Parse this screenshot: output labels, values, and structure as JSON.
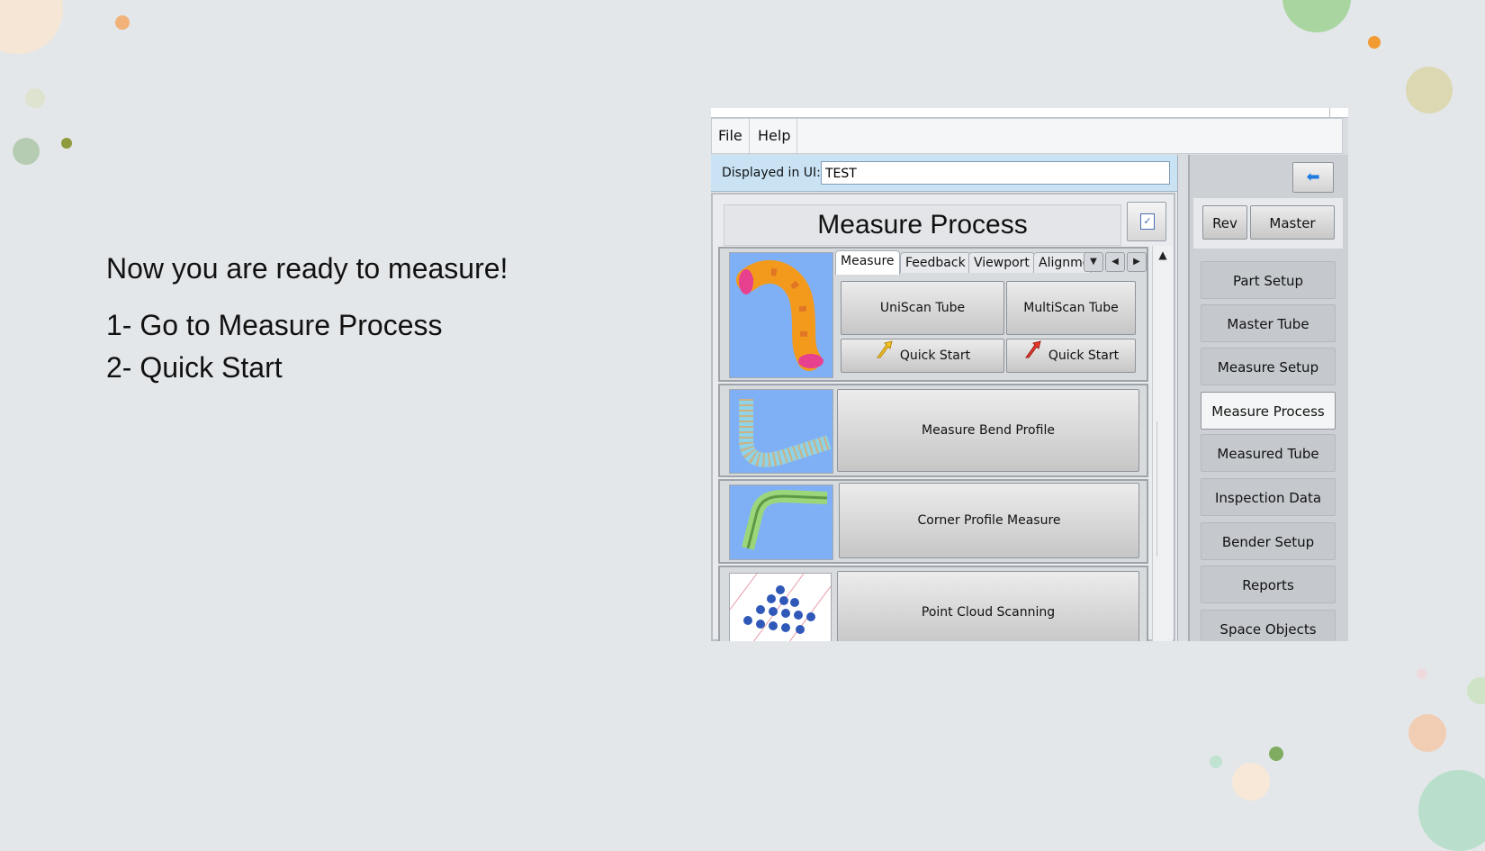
{
  "slide": {
    "heading": "Now you are ready to measure!",
    "steps": [
      "1- Go to Measure Process",
      "2- Quick Start"
    ]
  },
  "app": {
    "menu": [
      "File",
      "Help"
    ],
    "displayed_label": "Displayed in UI:",
    "displayed_value": "TEST",
    "title": "Measure Process",
    "tabs": [
      "Measure",
      "Feedback",
      "Viewport",
      "Alignme"
    ],
    "buttons": {
      "uniscan": "UniScan Tube",
      "multiscan": "MultiScan Tube",
      "quick_start_1": "Quick Start",
      "quick_start_2": "Quick Start",
      "bend_profile": "Measure Bend Profile",
      "corner_profile": "Corner Profile Measure",
      "point_cloud": "Point Cloud Scanning"
    },
    "sidebar": {
      "rev": "Rev",
      "master": "Master",
      "items": [
        "Part Setup",
        "Master Tube",
        "Measure Setup",
        "Measure Process",
        "Measured Tube",
        "Inspection Data",
        "Bender Setup",
        "Reports",
        "Space Objects"
      ],
      "active": "Measure Process"
    }
  },
  "colors": {
    "background": "#e4e7ea",
    "display_bar": "#c9e3f5",
    "accent_arrow": "#1f7ae0"
  },
  "icons": [
    "checklist-icon",
    "quick-start-yellow-icon",
    "quick-start-red-icon",
    "back-arrow-icon"
  ]
}
